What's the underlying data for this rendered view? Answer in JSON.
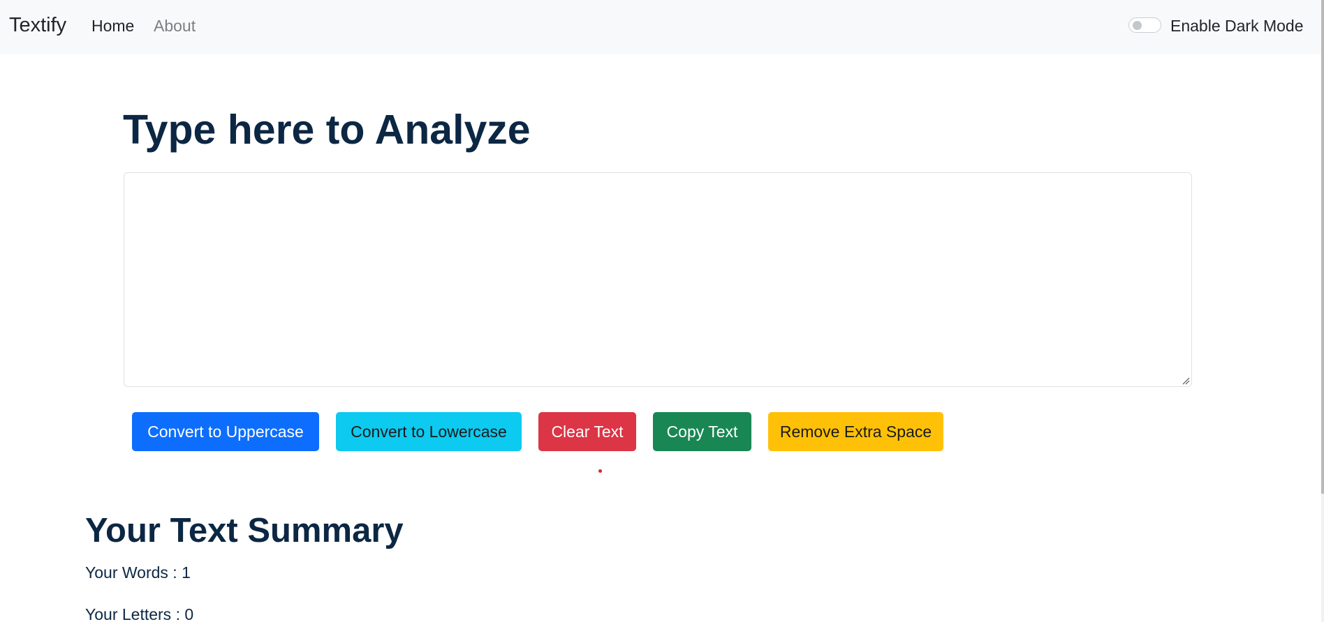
{
  "navbar": {
    "brand": "Textify",
    "links": [
      {
        "label": "Home",
        "active": true
      },
      {
        "label": "About",
        "active": false
      }
    ],
    "dark_mode": {
      "label": "Enable Dark Mode",
      "enabled": false
    }
  },
  "main": {
    "heading": "Type here to Analyze",
    "textarea": {
      "value": "",
      "placeholder": ""
    },
    "buttons": {
      "uppercase": "Convert to Uppercase",
      "lowercase": "Convert to Lowercase",
      "clear": "Clear Text",
      "copy": "Copy Text",
      "remove_space": "Remove Extra Space"
    }
  },
  "summary": {
    "heading": "Your Text Summary",
    "words_label": "Your Words : 1",
    "letters_label": "Your Letters : 0"
  },
  "colors": {
    "primary": "#0d6efd",
    "info": "#0dcaf0",
    "danger": "#dc3545",
    "success": "#198754",
    "warning": "#ffc107",
    "heading": "#0c2743",
    "navbar_bg": "#f8f9fa"
  }
}
